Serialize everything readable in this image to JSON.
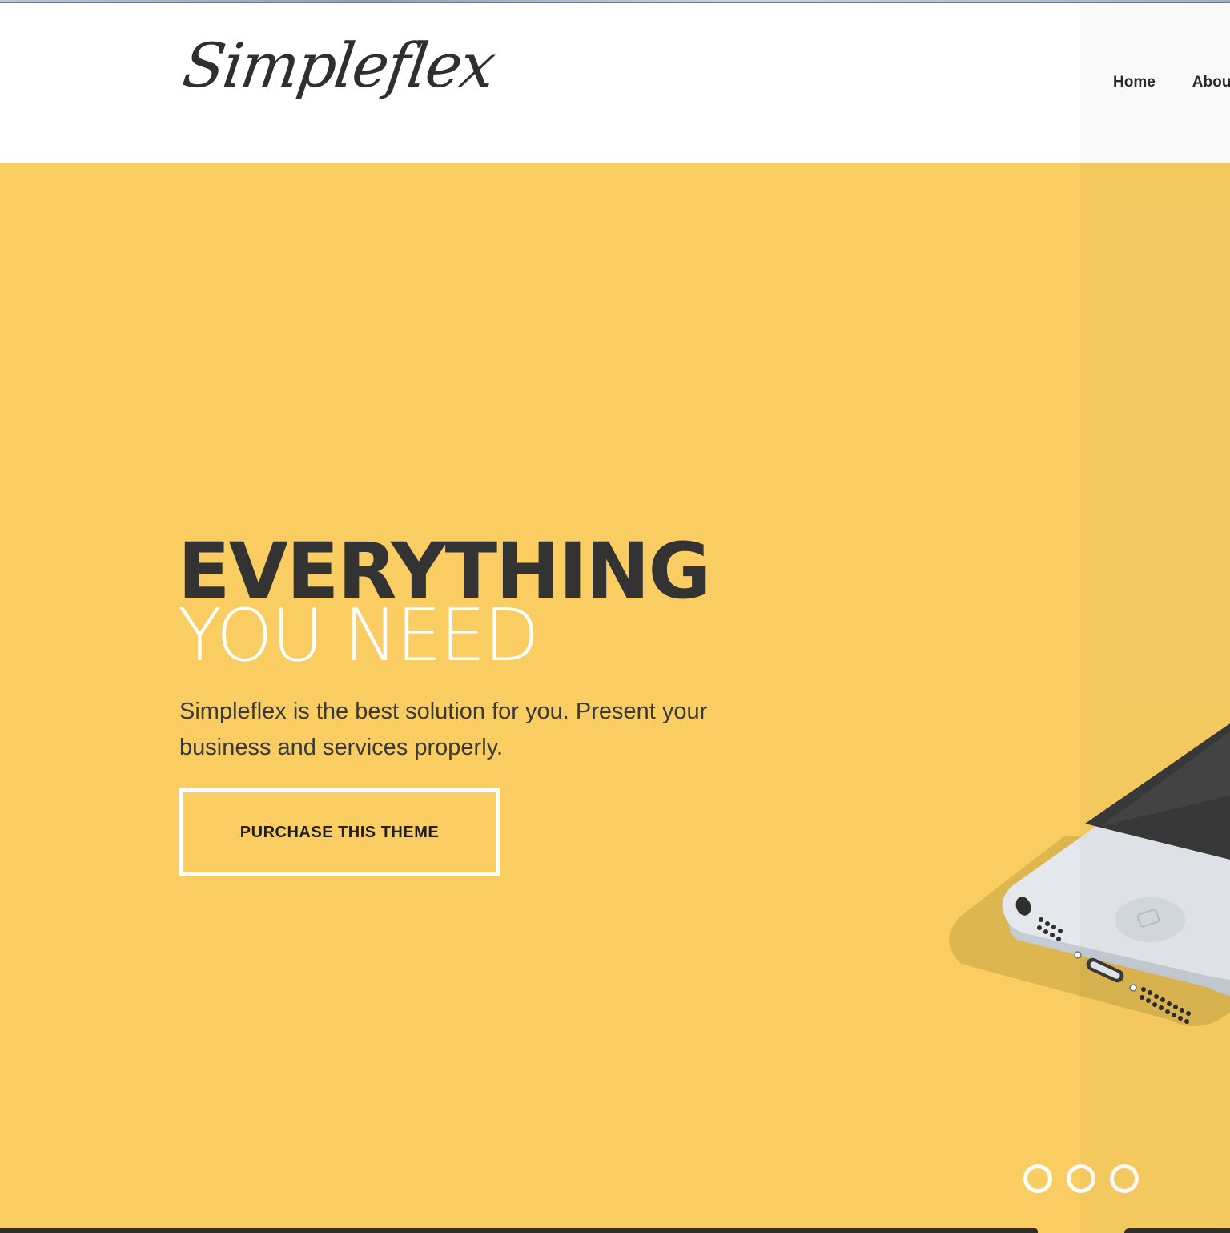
{
  "header": {
    "logo_text": "Simpleflex",
    "nav": [
      {
        "label": "Home"
      },
      {
        "label": "Abou"
      }
    ]
  },
  "hero": {
    "headline_bold": "EVERYTHING",
    "headline_light": "YOU NEED",
    "intro": "Simpleflex is the best solution for you. Present your business and services properly.",
    "cta_label": "PURCHASE THIS THEME",
    "slider_dot_count": 3
  },
  "colors": {
    "hero_background": "#f9cd62",
    "headline_dark": "#333333",
    "headline_light": "#ffffff",
    "header_background": "#ffffff"
  },
  "icons": {
    "hero_image": "iphone-mockup-illustration",
    "slider_dots": "slider-dot-icon"
  }
}
